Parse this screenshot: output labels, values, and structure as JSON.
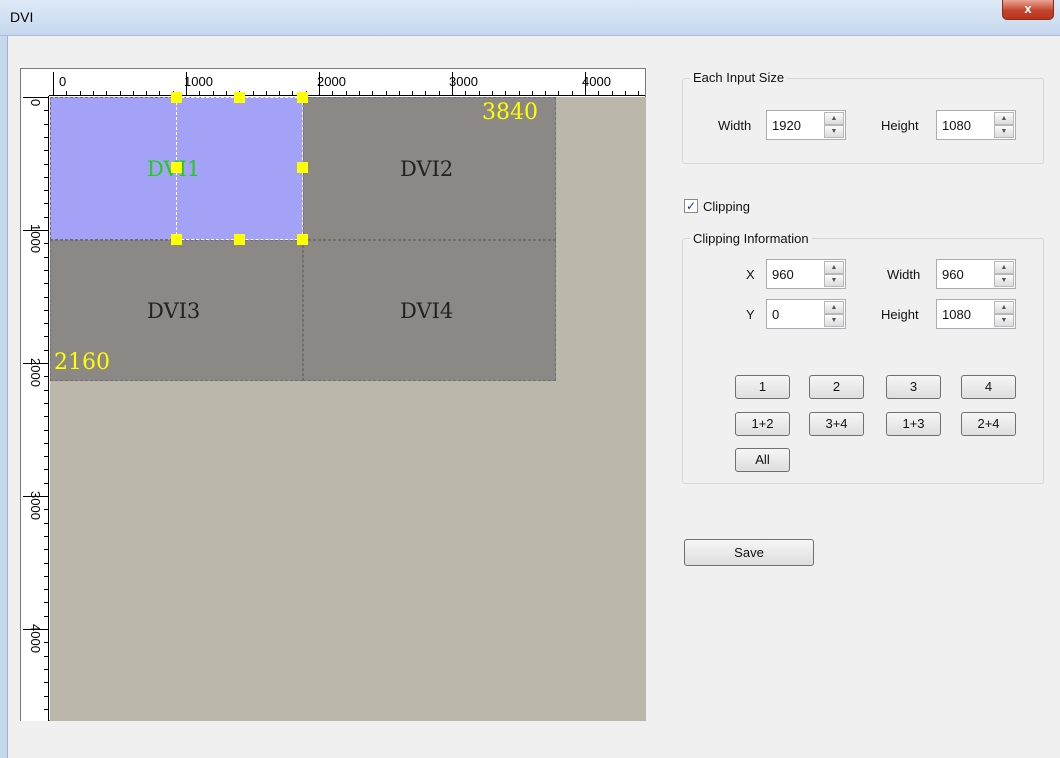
{
  "window": {
    "title": "DVI",
    "close_glyph": "x"
  },
  "canvas": {
    "ruler_top_labels": [
      "0",
      "1000",
      "2000",
      "3000",
      "4000"
    ],
    "ruler_left_labels": [
      "0",
      "1000",
      "2000",
      "3000",
      "4000"
    ],
    "screens": [
      {
        "label": "DVI1"
      },
      {
        "label": "DVI2"
      },
      {
        "label": "DVI3"
      },
      {
        "label": "DVI4"
      }
    ],
    "total_width_label": "3840",
    "total_height_label": "2160"
  },
  "input_size": {
    "group_title": "Each Input Size",
    "width_label": "Width",
    "width_value": "1920",
    "height_label": "Height",
    "height_value": "1080"
  },
  "clipping": {
    "checkbox_label": "Clipping",
    "checked": true,
    "group_title": "Clipping Information",
    "x_label": "X",
    "x_value": "960",
    "y_label": "Y",
    "y_value": "0",
    "width_label": "Width",
    "width_value": "960",
    "height_label": "Height",
    "height_value": "1080",
    "buttons": [
      "1",
      "2",
      "3",
      "4",
      "1+2",
      "3+4",
      "1+3",
      "2+4",
      "All"
    ]
  },
  "save_label": "Save"
}
